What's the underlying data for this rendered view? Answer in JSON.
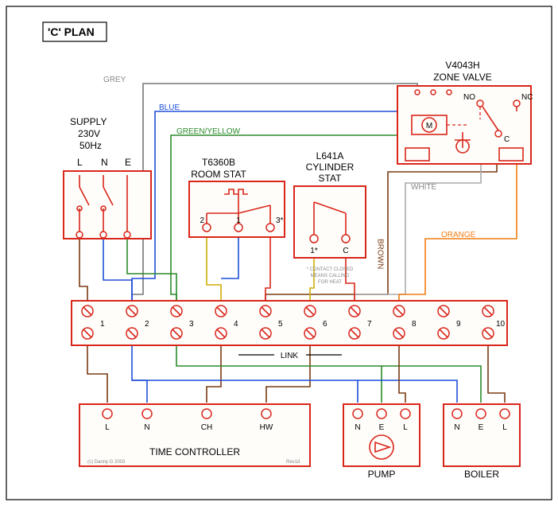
{
  "title": "'C' PLAN",
  "supply": {
    "label1": "SUPPLY",
    "label2": "230V",
    "label3": "50Hz",
    "L": "L",
    "N": "N",
    "E": "E"
  },
  "room_stat": {
    "label1": "T6360B",
    "label2": "ROOM STAT",
    "t1": "1",
    "t2": "2",
    "t3": "3*"
  },
  "cyl_stat": {
    "label1": "L641A",
    "label2": "CYLINDER",
    "label3": "STAT",
    "t1": "1*",
    "tC": "C",
    "note1": "* CONTACT CLOSED",
    "note2": "MEANS CALLING",
    "note3": "FOR HEAT"
  },
  "zone_valve": {
    "label1": "V4043H",
    "label2": "ZONE VALVE",
    "M": "M",
    "NO": "NO",
    "NC": "NC",
    "C": "C"
  },
  "junction": {
    "t1": "1",
    "t2": "2",
    "t3": "3",
    "t4": "4",
    "t5": "5",
    "t6": "6",
    "t7": "7",
    "t8": "8",
    "t9": "9",
    "t10": "10",
    "link": "LINK"
  },
  "time_controller": {
    "label": "TIME CONTROLLER",
    "L": "L",
    "N": "N",
    "CH": "CH",
    "HW": "HW"
  },
  "pump": {
    "label": "PUMP",
    "N": "N",
    "E": "E",
    "L": "L"
  },
  "boiler": {
    "label": "BOILER",
    "N": "N",
    "E": "E",
    "L": "L"
  },
  "wire_labels": {
    "grey": "GREY",
    "blue": "BLUE",
    "greenyellow": "GREEN/YELLOW",
    "brown": "BROWN",
    "white": "WHITE",
    "orange": "ORANGE"
  },
  "footer": {
    "copyright": "(c) Danny G 2003",
    "rev": "Rev1d"
  }
}
